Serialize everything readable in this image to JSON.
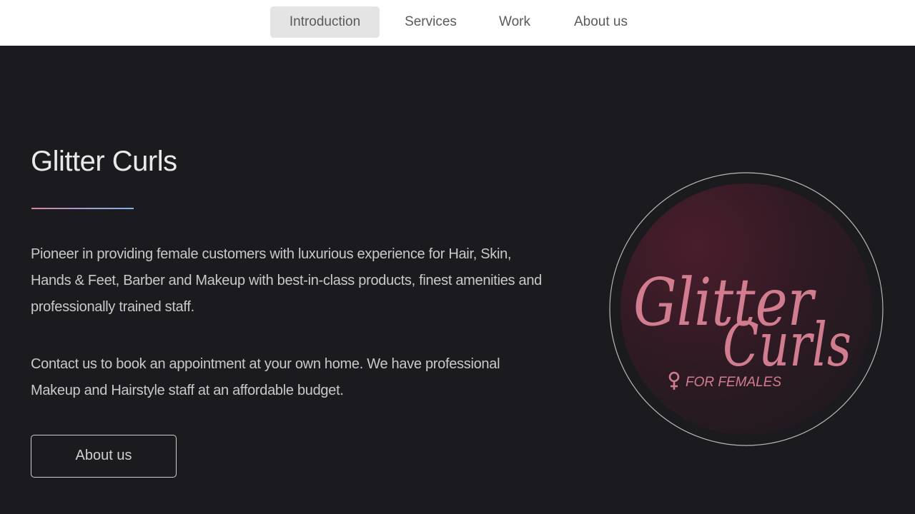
{
  "nav": {
    "items": [
      {
        "label": "Introduction",
        "active": true
      },
      {
        "label": "Services",
        "active": false
      },
      {
        "label": "Work",
        "active": false
      },
      {
        "label": "About us",
        "active": false
      }
    ]
  },
  "hero": {
    "title": "Glitter Curls",
    "paragraph_1": "Pioneer in providing female customers with luxurious experience for Hair, Skin, Hands & Feet, Barber and Makeup with best-in-class products, finest amenities and professionally trained staff.",
    "paragraph_2": "Contact us to book an appointment at your own home. We have professional Makeup and Hairstyle staff at an affordable budget.",
    "button_label": "About us"
  },
  "logo": {
    "line_1": "Glitter",
    "line_2": "Curls",
    "tagline": "FOR FEMALES",
    "icon": "female-symbol-icon"
  },
  "colors": {
    "background": "#1b1a1e",
    "nav_background": "#ffffff",
    "logo_pink": "#d27d8f",
    "divider_start": "#d9869a",
    "divider_end": "#7fb3e6"
  }
}
